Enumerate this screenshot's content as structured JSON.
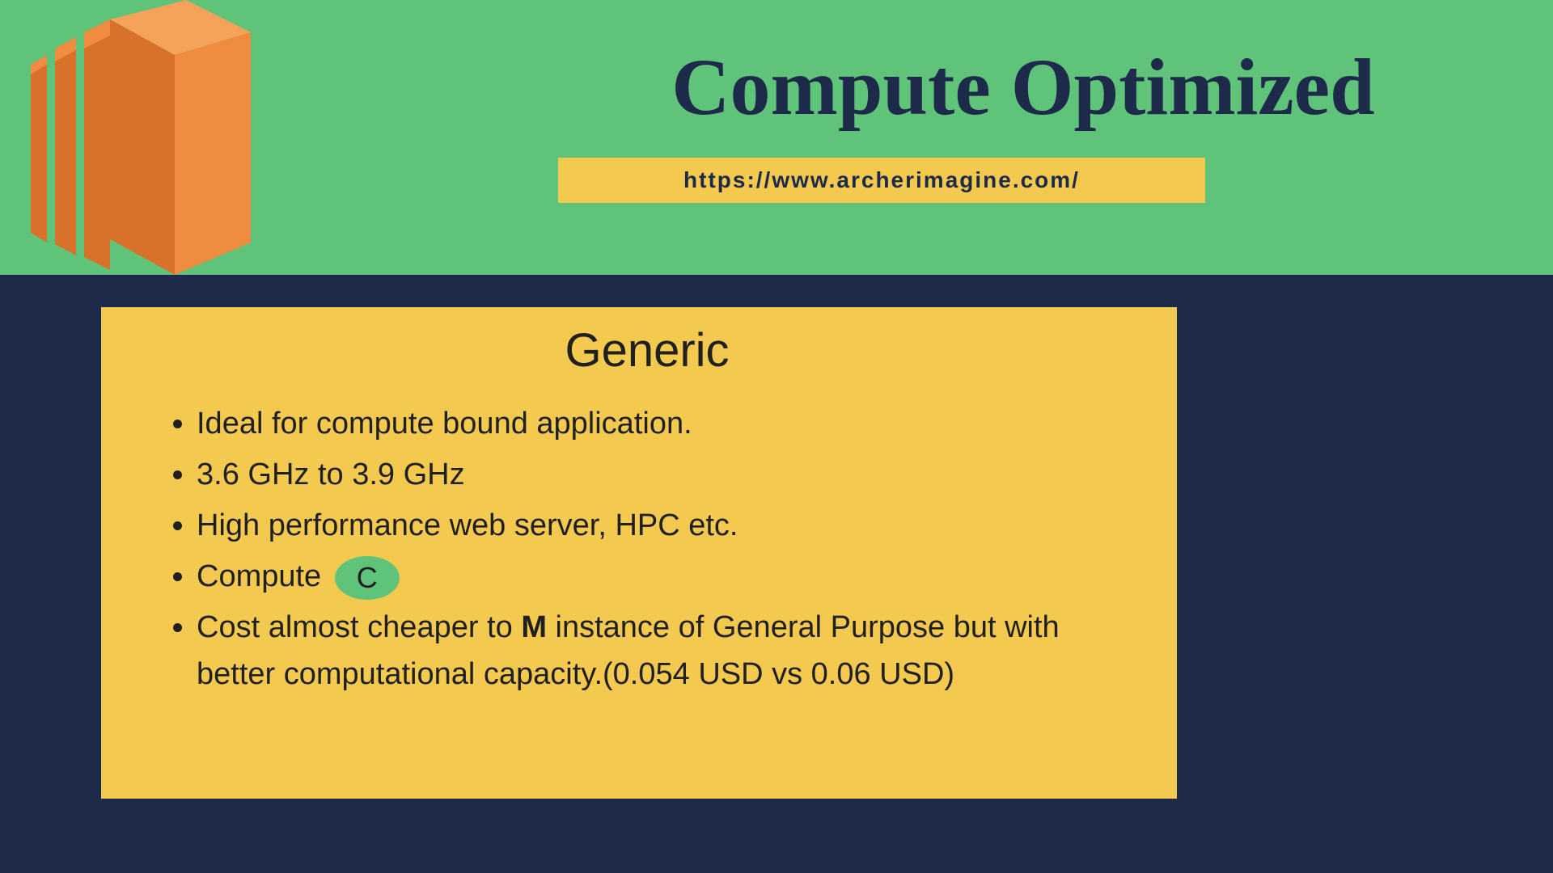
{
  "header": {
    "title": "Compute Optimized",
    "url": "https://www.archerimagine.com/"
  },
  "content": {
    "section_title": "Generic",
    "bullets": {
      "b1": "Ideal for compute bound application.",
      "b2": "3.6 GHz to 3.9 GHz",
      "b3": "High performance web server,  HPC etc.",
      "b4_prefix": "Compute ",
      "b4_badge": "C",
      "b5_prefix": "Cost almost cheaper to ",
      "b5_bold": "M",
      "b5_suffix": " instance of General Purpose but with better computational capacity.(0.054 USD vs 0.06 USD)"
    }
  },
  "colors": {
    "green": "#5fc47a",
    "navy": "#1e2a4a",
    "yellow": "#f4c94f",
    "orange_light": "#f08c3f",
    "orange_dark": "#d8722a"
  }
}
